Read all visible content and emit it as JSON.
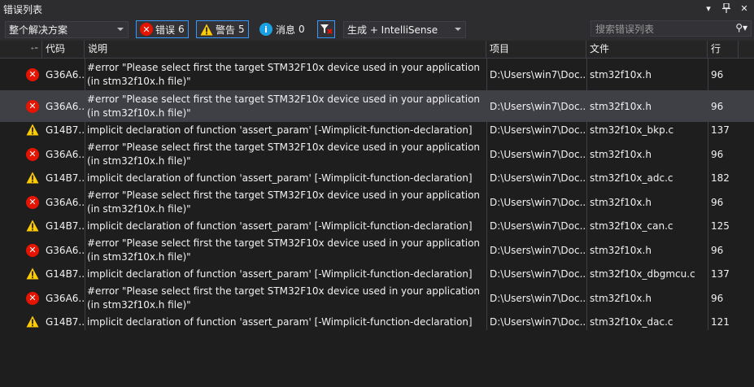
{
  "window": {
    "title": "错误列表"
  },
  "toolbar": {
    "scope": "整个解决方案",
    "errors_label": "错误",
    "errors_count": "6",
    "warnings_label": "警告",
    "warnings_count": "5",
    "messages_label": "消息",
    "messages_count": "0",
    "source": "生成 + IntelliSense",
    "search_placeholder": "搜索错误列表"
  },
  "columns": {
    "code": "代码",
    "description": "说明",
    "project": "项目",
    "file": "文件",
    "line": "行"
  },
  "rows": [
    {
      "type": "error",
      "code": "G36A6...",
      "desc": "#error \"Please select first the target STM32F10x device used in your application (in stm32f10x.h file)\"",
      "project": "D:\\Users\\win7\\Doc...",
      "file": "stm32f10x.h",
      "line": "96",
      "selected": false
    },
    {
      "type": "error",
      "code": "G36A6...",
      "desc": "#error \"Please select first the target STM32F10x device used in your application (in stm32f10x.h file)\"",
      "project": "D:\\Users\\win7\\Doc...",
      "file": "stm32f10x.h",
      "line": "96",
      "selected": true
    },
    {
      "type": "warning",
      "code": "G14B7...",
      "desc": "implicit declaration of function 'assert_param' [-Wimplicit-function-declaration]",
      "project": "D:\\Users\\win7\\Doc...",
      "file": "stm32f10x_bkp.c",
      "line": "137",
      "selected": false
    },
    {
      "type": "error",
      "code": "G36A6...",
      "desc": "#error \"Please select first the target STM32F10x device used in your application (in stm32f10x.h file)\"",
      "project": "D:\\Users\\win7\\Doc...",
      "file": "stm32f10x.h",
      "line": "96",
      "selected": false
    },
    {
      "type": "warning",
      "code": "G14B7...",
      "desc": "implicit declaration of function 'assert_param' [-Wimplicit-function-declaration]",
      "project": "D:\\Users\\win7\\Doc...",
      "file": "stm32f10x_adc.c",
      "line": "182",
      "selected": false
    },
    {
      "type": "error",
      "code": "G36A6...",
      "desc": "#error \"Please select first the target STM32F10x device used in your application (in stm32f10x.h file)\"",
      "project": "D:\\Users\\win7\\Doc...",
      "file": "stm32f10x.h",
      "line": "96",
      "selected": false
    },
    {
      "type": "warning",
      "code": "G14B7...",
      "desc": "implicit declaration of function 'assert_param' [-Wimplicit-function-declaration]",
      "project": "D:\\Users\\win7\\Doc...",
      "file": "stm32f10x_can.c",
      "line": "125",
      "selected": false
    },
    {
      "type": "error",
      "code": "G36A6...",
      "desc": "#error \"Please select first the target STM32F10x device used in your application (in stm32f10x.h file)\"",
      "project": "D:\\Users\\win7\\Doc...",
      "file": "stm32f10x.h",
      "line": "96",
      "selected": false
    },
    {
      "type": "warning",
      "code": "G14B7...",
      "desc": "implicit declaration of function 'assert_param' [-Wimplicit-function-declaration]",
      "project": "D:\\Users\\win7\\Doc...",
      "file": "stm32f10x_dbgmcu.c",
      "line": "137",
      "selected": false
    },
    {
      "type": "error",
      "code": "G36A6...",
      "desc": "#error \"Please select first the target STM32F10x device used in your application (in stm32f10x.h file)\"",
      "project": "D:\\Users\\win7\\Doc...",
      "file": "stm32f10x.h",
      "line": "96",
      "selected": false
    },
    {
      "type": "warning",
      "code": "G14B7...",
      "desc": "implicit declaration of function 'assert_param' [-Wimplicit-function-declaration]",
      "project": "D:\\Users\\win7\\Doc...",
      "file": "stm32f10x_dac.c",
      "line": "121",
      "selected": false
    }
  ],
  "colors": {
    "error": "#e51400",
    "warning": "#ffcc00",
    "info": "#1ba1e2",
    "accent": "#3399ff"
  }
}
